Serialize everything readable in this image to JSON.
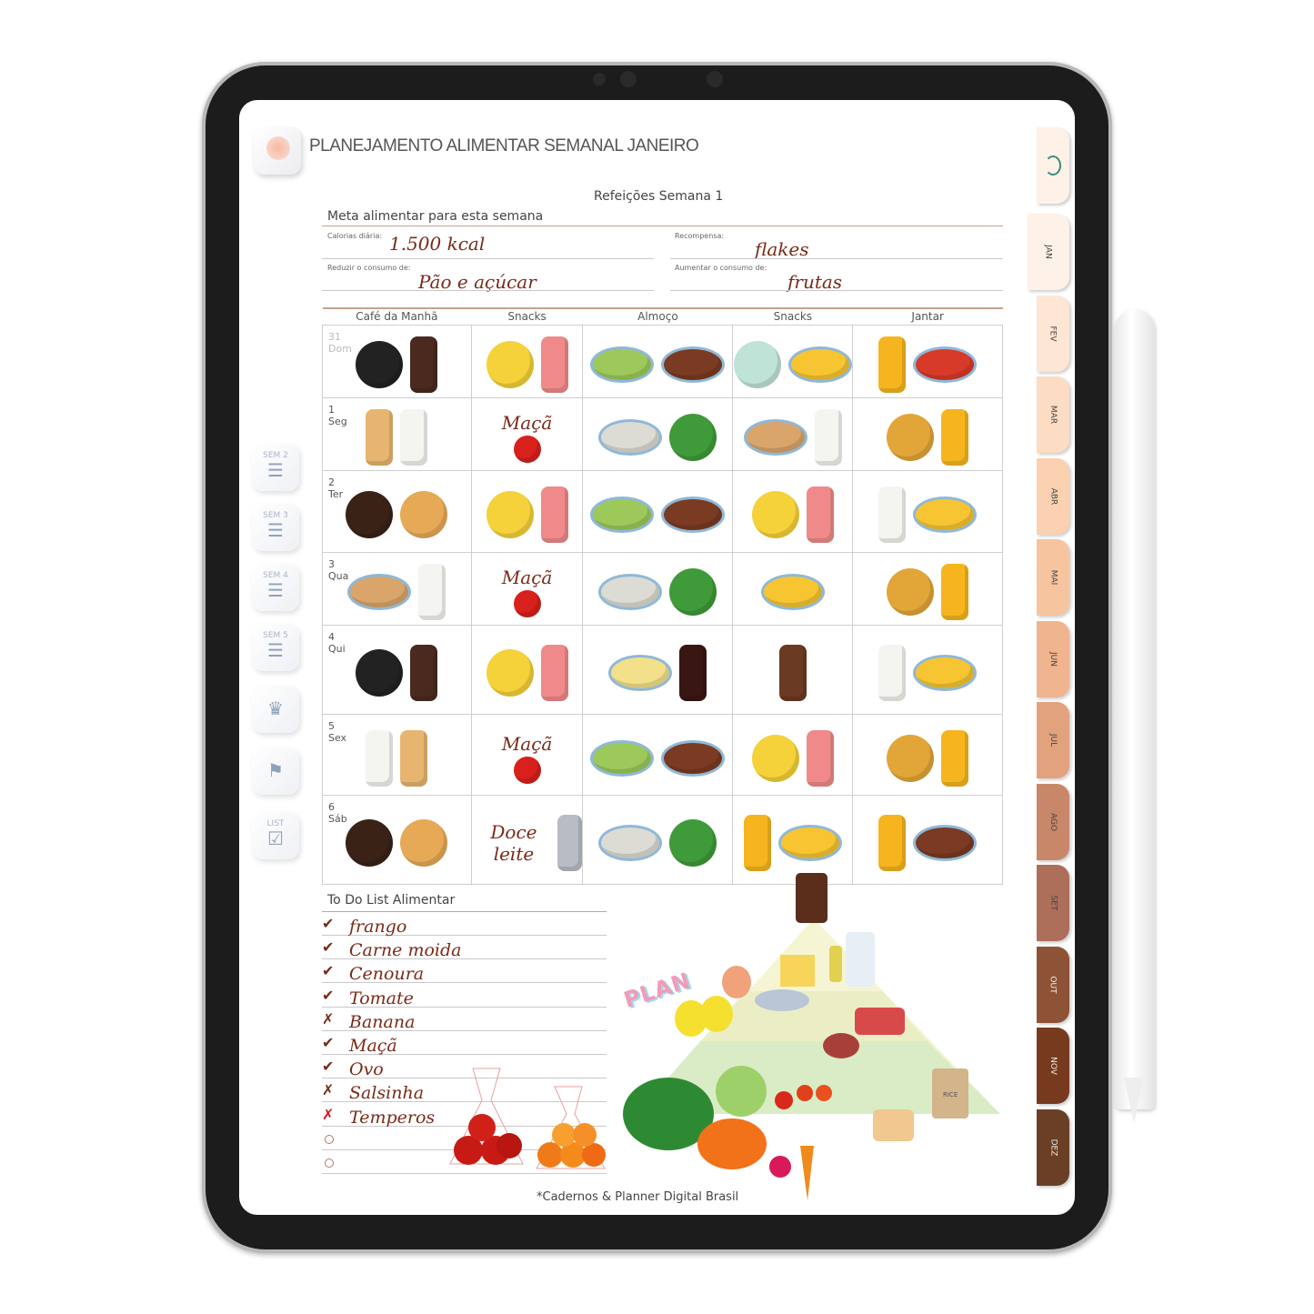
{
  "header": {
    "title": "PLANEJAMENTO ALIMENTAR SEMANAL JANEIRO",
    "subtitle": "Refeições Semana 1"
  },
  "goals": {
    "heading": "Meta alimentar para esta semana",
    "calories_label": "Calorias diária:",
    "calories_value": "1.500 kcal",
    "reward_label": "Recompensa:",
    "reward_value": "flakes",
    "reduce_label": "Reduzir o consumo de:",
    "reduce_value": "Pão e açúcar",
    "increase_label": "Aumentar o consumo de:",
    "increase_value": "frutas"
  },
  "table": {
    "columns": [
      "Café da Manhã",
      "Snacks",
      "Almoço",
      "Snacks",
      "Jantar"
    ],
    "rows": [
      {
        "num": "31",
        "day": "Dom",
        "cells": [
          {
            "foods": [
              "fried-egg-pan",
              "iced-coffee"
            ]
          },
          {
            "foods": [
              "banana",
              "bubble-tea"
            ]
          },
          {
            "foods": [
              "salad-bowl",
              "steak-plate"
            ]
          },
          {
            "foods": [
              "tea-cup",
              "omelette-plate"
            ]
          },
          {
            "foods": [
              "orange-juice",
              "spaghetti-plate"
            ]
          }
        ]
      },
      {
        "num": "1",
        "day": "Seg",
        "cells": [
          {
            "foods": [
              "baguette",
              "milk-glass"
            ]
          },
          {
            "text": "Maçã",
            "foods": [
              "apple"
            ]
          },
          {
            "foods": [
              "soup-bowl",
              "green-salad"
            ]
          },
          {
            "foods": [
              "sandwich",
              "milk-glass"
            ]
          },
          {
            "foods": [
              "taco",
              "orange-juice"
            ]
          }
        ]
      },
      {
        "num": "2",
        "day": "Ter",
        "cells": [
          {
            "foods": [
              "coffee-cup",
              "bread-loaf"
            ]
          },
          {
            "foods": [
              "banana",
              "bubble-tea"
            ]
          },
          {
            "foods": [
              "salad-bowl",
              "steak-plate"
            ]
          },
          {
            "foods": [
              "banana",
              "bubble-tea"
            ]
          },
          {
            "foods": [
              "milk-glass",
              "omelette-plate"
            ]
          }
        ]
      },
      {
        "num": "3",
        "day": "Qua",
        "cells": [
          {
            "foods": [
              "sandwich",
              "milk-glass"
            ]
          },
          {
            "text": "Maçã",
            "foods": [
              "apple"
            ]
          },
          {
            "foods": [
              "soup-bowl",
              "green-salad"
            ]
          },
          {
            "foods": [
              "omelette-plate"
            ]
          },
          {
            "foods": [
              "taco",
              "orange-juice"
            ]
          }
        ]
      },
      {
        "num": "4",
        "day": "Qui",
        "cells": [
          {
            "foods": [
              "fried-egg-pan",
              "iced-coffee"
            ]
          },
          {
            "foods": [
              "banana",
              "bubble-tea"
            ]
          },
          {
            "foods": [
              "pasta-plate",
              "cola-bottle"
            ]
          },
          {
            "foods": [
              "chocolate-frappe"
            ]
          },
          {
            "foods": [
              "milk-glass",
              "omelette-plate"
            ]
          }
        ]
      },
      {
        "num": "5",
        "day": "Sex",
        "cells": [
          {
            "foods": [
              "milk-glass",
              "baguette"
            ]
          },
          {
            "text": "Maçã",
            "foods": [
              "apple"
            ]
          },
          {
            "foods": [
              "salad-bowl",
              "steak-plate"
            ]
          },
          {
            "foods": [
              "banana",
              "bubble-tea"
            ]
          },
          {
            "foods": [
              "taco",
              "orange-juice"
            ]
          }
        ]
      },
      {
        "num": "6",
        "day": "Sáb",
        "cells": [
          {
            "foods": [
              "coffee-cup",
              "bread-loaf"
            ]
          },
          {
            "text": "Doce leite",
            "foods": [
              "spoon"
            ]
          },
          {
            "foods": [
              "soup-bowl",
              "green-salad"
            ]
          },
          {
            "foods": [
              "orange-juice",
              "omelette-plate"
            ]
          },
          {
            "foods": [
              "orange-juice",
              "steak-plate"
            ]
          }
        ]
      }
    ]
  },
  "food_colors": {
    "fried-egg-pan": "#222222",
    "iced-coffee": "#4a2a1e",
    "banana": "#f5d13a",
    "bubble-tea": "#f08a8a",
    "salad-bowl": "#9cc95a",
    "steak-plate": "#7a3b22",
    "tea-cup": "#bfe3d6",
    "omelette-plate": "#f7c531",
    "orange-juice": "#f6b51e",
    "spaghetti-plate": "#d83a2a",
    "baguette": "#e8b570",
    "milk-glass": "#f4f4f0",
    "apple": "#d8201c",
    "soup-bowl": "#dcdcd4",
    "green-salad": "#3f9a3a",
    "sandwich": "#d9a56a",
    "taco": "#e2a537",
    "coffee-cup": "#3a2217",
    "bread-loaf": "#e6a956",
    "pasta-plate": "#f3e08a",
    "cola-bottle": "#3a1612",
    "chocolate-frappe": "#6b3a22",
    "spoon": "#b8bcc4"
  },
  "sidebar": [
    {
      "label": "SEM 2",
      "icon": "cutlery-icon"
    },
    {
      "label": "SEM 3",
      "icon": "cutlery-icon"
    },
    {
      "label": "SEM 4",
      "icon": "cutlery-icon"
    },
    {
      "label": "SEM 5",
      "icon": "cutlery-icon"
    },
    {
      "label": "",
      "icon": "chef-hat-icon"
    },
    {
      "label": "",
      "icon": "route-flags-icon"
    },
    {
      "label": "LIST",
      "icon": "checklist-icon"
    }
  ],
  "tabs": [
    {
      "label": "JAN",
      "color": "#fdf1e8"
    },
    {
      "label": "FEV",
      "color": "#fde6d3"
    },
    {
      "label": "MAR",
      "color": "#fcdcc2"
    },
    {
      "label": "ABR",
      "color": "#fbd1b1"
    },
    {
      "label": "MAI",
      "color": "#f7c4a0"
    },
    {
      "label": "JUN",
      "color": "#f0b48e"
    },
    {
      "label": "JUL",
      "color": "#e2a27d"
    },
    {
      "label": "AGO",
      "color": "#c9876a"
    },
    {
      "label": "SET",
      "color": "#ad6f5a"
    },
    {
      "label": "OUT",
      "color": "#8e5236"
    },
    {
      "label": "NOV",
      "color": "#773a1f"
    },
    {
      "label": "DEZ",
      "color": "#6a3f26"
    }
  ],
  "todo": {
    "heading": "To Do List Alimentar",
    "items": [
      {
        "text": "frango",
        "status": "done"
      },
      {
        "text": "Carne moida",
        "status": "done"
      },
      {
        "text": "Cenoura",
        "status": "done"
      },
      {
        "text": "Tomate",
        "status": "done"
      },
      {
        "text": "Banana",
        "status": "crossed"
      },
      {
        "text": "Maçã",
        "status": "done"
      },
      {
        "text": "Ovo",
        "status": "done"
      },
      {
        "text": "Salsinha",
        "status": "crossed"
      },
      {
        "text": "Temperos",
        "status": "crossed-red"
      },
      {
        "text": "",
        "status": "empty"
      },
      {
        "text": "",
        "status": "empty"
      }
    ]
  },
  "pyramid": {
    "label": "PLAN",
    "rice_label": "RICE"
  },
  "footer": "*Cadernos & Planner Digital Brasil"
}
